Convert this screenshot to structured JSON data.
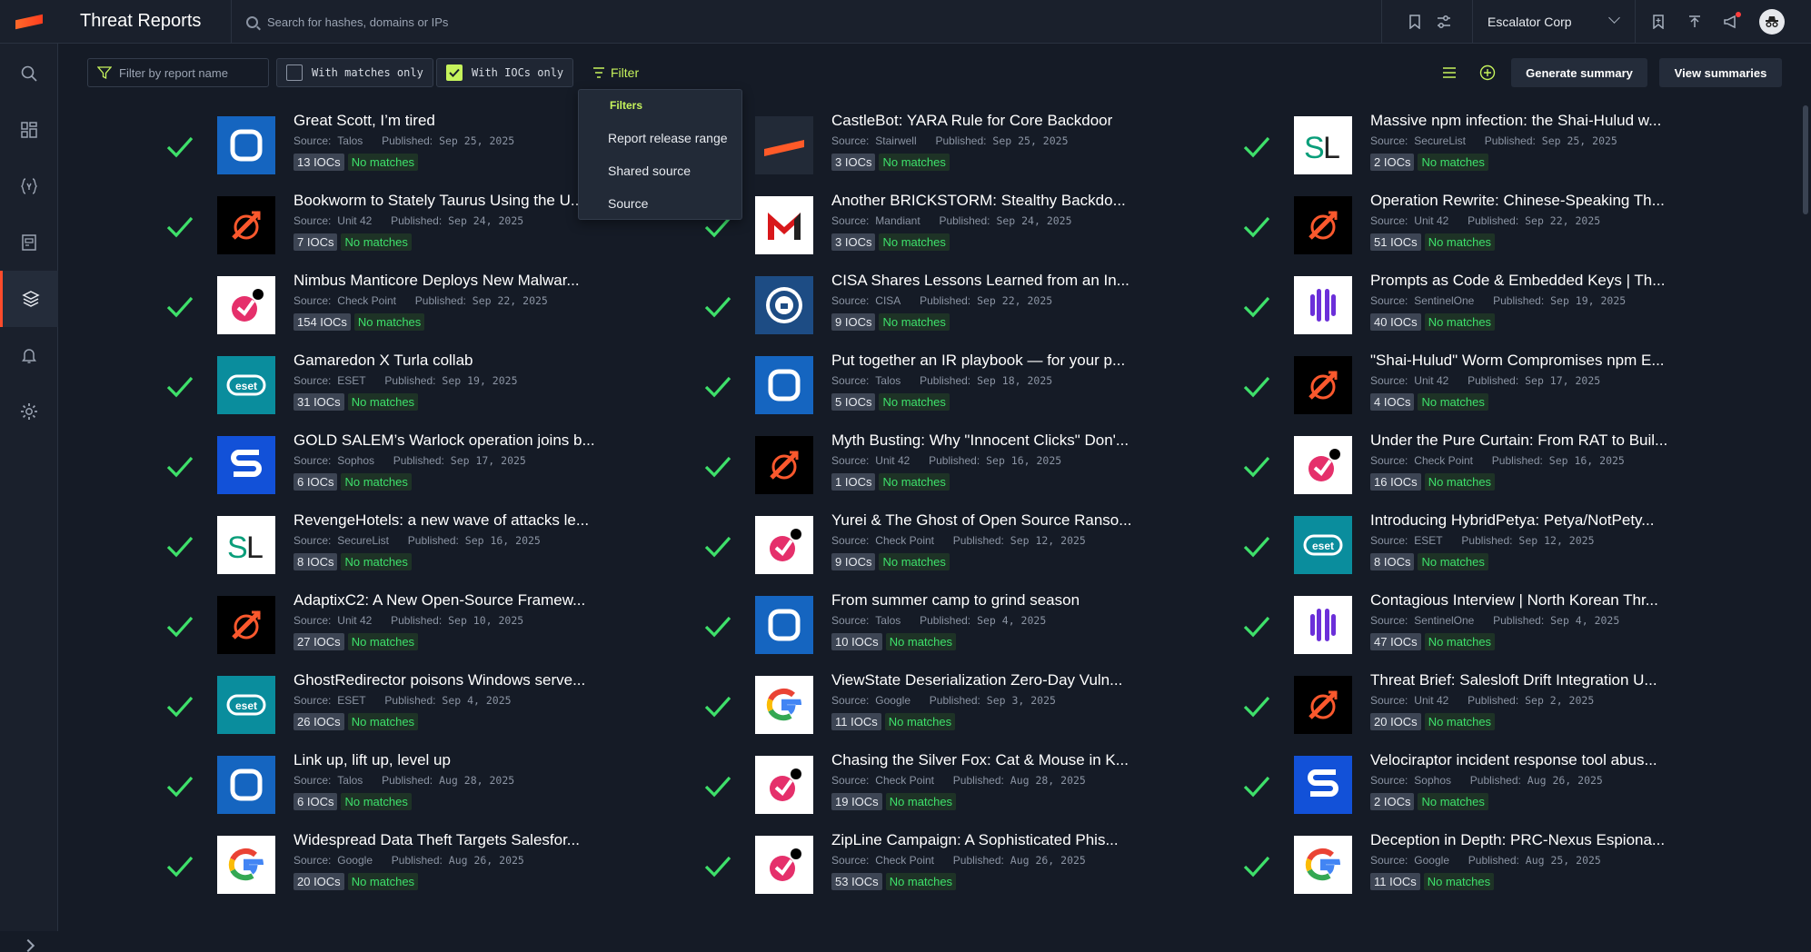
{
  "app": {
    "title": "Threat Reports"
  },
  "search": {
    "placeholder": "Search for hashes, domains or IPs"
  },
  "org": {
    "name": "Escalator Corp"
  },
  "toolbar": {
    "filter_placeholder": "Filter by report name",
    "with_matches_label": "With matches only",
    "with_iocs_label": "With IOCs only",
    "filter_label": "Filter",
    "generate_summary": "Generate summary",
    "view_summaries": "View summaries"
  },
  "dropdown": {
    "header": "Filters",
    "options": [
      "Report release range",
      "Shared source",
      "Source"
    ]
  },
  "colors": {
    "accent": "#c6f35c",
    "success": "#3ee06a",
    "brand": "#ff4b2b"
  },
  "sidebar": {
    "items": [
      "search-icon",
      "dashboard-icon",
      "yara-icon",
      "reports-icon",
      "layers-icon",
      "bell-icon",
      "gear-icon"
    ]
  },
  "reports": [
    {
      "title": "Great Scott, I’m tired",
      "source": "Talos",
      "published": "Sep 25, 2025",
      "iocs": "13 IOCs",
      "match": "No matches",
      "logo": "talos"
    },
    {
      "title": "CastleBot: YARA Rule for Core Backdoor",
      "source": "Stairwell",
      "published": "Sep 25, 2025",
      "iocs": "3 IOCs",
      "match": "No matches",
      "logo": "stairwell"
    },
    {
      "title": "Massive npm infection: the Shai-Hulud w...",
      "source": "SecureList",
      "published": "Sep 25, 2025",
      "iocs": "2 IOCs",
      "match": "No matches",
      "logo": "securelist"
    },
    {
      "title": "Bookworm to Stately Taurus Using the U...",
      "source": "Unit 42",
      "published": "Sep 24, 2025",
      "iocs": "7 IOCs",
      "match": "No matches",
      "logo": "unit42"
    },
    {
      "title": "Another BRICKSTORM: Stealthy Backdo...",
      "source": "Mandiant",
      "published": "Sep 24, 2025",
      "iocs": "3 IOCs",
      "match": "No matches",
      "logo": "mandiant"
    },
    {
      "title": "Operation Rewrite: Chinese-Speaking Th...",
      "source": "Unit 42",
      "published": "Sep 22, 2025",
      "iocs": "51 IOCs",
      "match": "No matches",
      "logo": "unit42"
    },
    {
      "title": "Nimbus Manticore Deploys New Malwar...",
      "source": "Check Point",
      "published": "Sep 22, 2025",
      "iocs": "154 IOCs",
      "match": "No matches",
      "logo": "checkpoint"
    },
    {
      "title": "CISA Shares Lessons Learned from an In...",
      "source": "CISA",
      "published": "Sep 22, 2025",
      "iocs": "9 IOCs",
      "match": "No matches",
      "logo": "cisa"
    },
    {
      "title": "Prompts as Code & Embedded Keys | Th...",
      "source": "SentinelOne",
      "published": "Sep 19, 2025",
      "iocs": "40 IOCs",
      "match": "No matches",
      "logo": "sentinelone"
    },
    {
      "title": "Gamaredon X Turla collab",
      "source": "ESET",
      "published": "Sep 19, 2025",
      "iocs": "31 IOCs",
      "match": "No matches",
      "logo": "eset"
    },
    {
      "title": "Put together an IR playbook — for your p...",
      "source": "Talos",
      "published": "Sep 18, 2025",
      "iocs": "5 IOCs",
      "match": "No matches",
      "logo": "talos"
    },
    {
      "title": "\"Shai-Hulud\" Worm Compromises npm E...",
      "source": "Unit 42",
      "published": "Sep 17, 2025",
      "iocs": "4 IOCs",
      "match": "No matches",
      "logo": "unit42"
    },
    {
      "title": "GOLD SALEM’s Warlock operation joins b...",
      "source": "Sophos",
      "published": "Sep 17, 2025",
      "iocs": "6 IOCs",
      "match": "No matches",
      "logo": "sophos"
    },
    {
      "title": "Myth Busting: Why \"Innocent Clicks\" Don'...",
      "source": "Unit 42",
      "published": "Sep 16, 2025",
      "iocs": "1 IOCs",
      "match": "No matches",
      "logo": "unit42"
    },
    {
      "title": "Under the Pure Curtain: From RAT to Buil...",
      "source": "Check Point",
      "published": "Sep 16, 2025",
      "iocs": "16 IOCs",
      "match": "No matches",
      "logo": "checkpoint"
    },
    {
      "title": "RevengeHotels: a new wave of attacks le...",
      "source": "SecureList",
      "published": "Sep 16, 2025",
      "iocs": "8 IOCs",
      "match": "No matches",
      "logo": "securelist"
    },
    {
      "title": "Yurei & The Ghost of Open Source Ranso...",
      "source": "Check Point",
      "published": "Sep 12, 2025",
      "iocs": "9 IOCs",
      "match": "No matches",
      "logo": "checkpoint"
    },
    {
      "title": "Introducing HybridPetya: Petya/NotPety...",
      "source": "ESET",
      "published": "Sep 12, 2025",
      "iocs": "8 IOCs",
      "match": "No matches",
      "logo": "eset"
    },
    {
      "title": "AdaptixC2: A New Open-Source Framew...",
      "source": "Unit 42",
      "published": "Sep 10, 2025",
      "iocs": "27 IOCs",
      "match": "No matches",
      "logo": "unit42"
    },
    {
      "title": "From summer camp to grind season",
      "source": "Talos",
      "published": "Sep 4, 2025",
      "iocs": "10 IOCs",
      "match": "No matches",
      "logo": "talos"
    },
    {
      "title": "Contagious Interview | North Korean Thr...",
      "source": "SentinelOne",
      "published": "Sep 4, 2025",
      "iocs": "47 IOCs",
      "match": "No matches",
      "logo": "sentinelone"
    },
    {
      "title": "GhostRedirector poisons Windows serve...",
      "source": "ESET",
      "published": "Sep 4, 2025",
      "iocs": "26 IOCs",
      "match": "No matches",
      "logo": "eset"
    },
    {
      "title": "ViewState Deserialization Zero-Day Vuln...",
      "source": "Google",
      "published": "Sep 3, 2025",
      "iocs": "11 IOCs",
      "match": "No matches",
      "logo": "google"
    },
    {
      "title": "Threat Brief: Salesloft Drift Integration U...",
      "source": "Unit 42",
      "published": "Sep 2, 2025",
      "iocs": "20 IOCs",
      "match": "No matches",
      "logo": "unit42"
    },
    {
      "title": "Link up, lift up, level up",
      "source": "Talos",
      "published": "Aug 28, 2025",
      "iocs": "6 IOCs",
      "match": "No matches",
      "logo": "talos"
    },
    {
      "title": "Chasing the Silver Fox: Cat & Mouse in K...",
      "source": "Check Point",
      "published": "Aug 28, 2025",
      "iocs": "19 IOCs",
      "match": "No matches",
      "logo": "checkpoint"
    },
    {
      "title": "Velociraptor incident response tool abus...",
      "source": "Sophos",
      "published": "Aug 26, 2025",
      "iocs": "2 IOCs",
      "match": "No matches",
      "logo": "sophos"
    },
    {
      "title": "Widespread Data Theft Targets Salesfor...",
      "source": "Google",
      "published": "Aug 26, 2025",
      "iocs": "20 IOCs",
      "match": "No matches",
      "logo": "google"
    },
    {
      "title": "ZipLine Campaign: A Sophisticated Phis...",
      "source": "Check Point",
      "published": "Aug 26, 2025",
      "iocs": "53 IOCs",
      "match": "No matches",
      "logo": "checkpoint"
    },
    {
      "title": "Deception in Depth: PRC-Nexus Espiona...",
      "source": "Google",
      "published": "Aug 25, 2025",
      "iocs": "11 IOCs",
      "match": "No matches",
      "logo": "google"
    }
  ],
  "labels": {
    "source_prefix": "Source:",
    "published_prefix": "Published:"
  }
}
